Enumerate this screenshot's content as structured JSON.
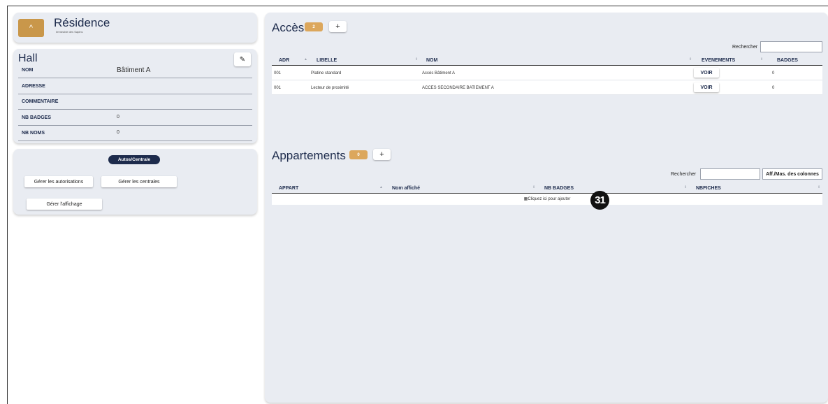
{
  "residence": {
    "collapse_icon": "chevron-up-icon",
    "title": "Résidence",
    "subtitle": "Immeuble des Sapins"
  },
  "hall": {
    "title": "Hall",
    "edit_icon": "pencil-icon",
    "rows": [
      {
        "key": "NOM",
        "value": "Bâtiment A"
      },
      {
        "key": "ADRESSE",
        "value": ""
      },
      {
        "key": "COMMENTAIRE",
        "value": ""
      },
      {
        "key": "NB BADGES",
        "value": "0"
      },
      {
        "key": "NB NOMS",
        "value": "0"
      }
    ]
  },
  "autos": {
    "tag": "Autos/Centrale",
    "btn_autorisations": "Gérer les autorisations",
    "btn_centrales": "Gérer les centrales",
    "btn_affichage": "Gérer l'affichage"
  },
  "acces": {
    "title": "Accès",
    "count": "2",
    "add_label": "+",
    "search_label": "Rechercher",
    "search_value": "",
    "columns": [
      "ADR",
      "LIBELLE",
      "NOM",
      "EVENEMENTS",
      "BADGES"
    ],
    "rows": [
      {
        "adr": "001",
        "libelle": "Platine standard",
        "nom": "Accès Bâtiment A",
        "evenements": "VOIR",
        "badges": "0"
      },
      {
        "adr": "001",
        "libelle": "Lecteur de proximité",
        "nom": "ACCES SECONDAIRE BATIEMENT A",
        "evenements": "VOIR",
        "badges": "0"
      }
    ]
  },
  "appartements": {
    "title": "Appartements",
    "count": "0",
    "add_label": "+",
    "search_label": "Rechercher",
    "search_value": "",
    "cols_button": "Aff./Mas. des colonnes",
    "columns": [
      "APPART",
      "Nom affiché",
      "NB BADGES",
      "NBFICHES"
    ],
    "empty_text": "Cliquez ici pour ajouter"
  },
  "step_marker": "31",
  "colors": {
    "accent": "#c9974a",
    "badge": "#dca75c",
    "navy": "#1d2b4c",
    "panel": "#e9ecf2"
  }
}
